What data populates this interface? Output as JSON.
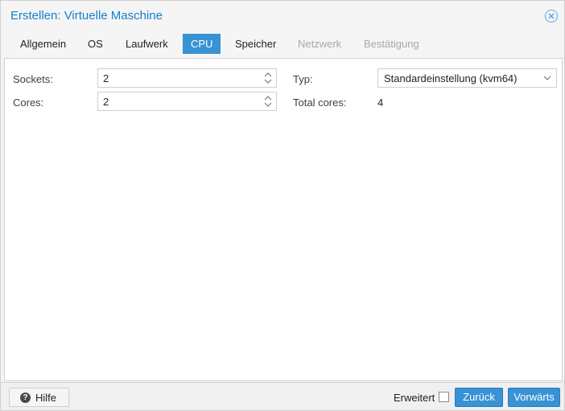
{
  "window": {
    "title": "Erstellen: Virtuelle Maschine"
  },
  "tabs": [
    {
      "label": "Allgemein",
      "state": "normal"
    },
    {
      "label": "OS",
      "state": "normal"
    },
    {
      "label": "Laufwerk",
      "state": "normal"
    },
    {
      "label": "CPU",
      "state": "active"
    },
    {
      "label": "Speicher",
      "state": "normal"
    },
    {
      "label": "Netzwerk",
      "state": "disabled"
    },
    {
      "label": "Bestätigung",
      "state": "disabled"
    }
  ],
  "form": {
    "sockets": {
      "label": "Sockets:",
      "value": "2"
    },
    "cores": {
      "label": "Cores:",
      "value": "2"
    },
    "type": {
      "label": "Typ:",
      "value": "Standardeinstellung (kvm64)"
    },
    "total_cores": {
      "label": "Total cores:",
      "value": "4"
    }
  },
  "footer": {
    "help_label": "Hilfe",
    "advanced_label": "Erweitert",
    "advanced_checked": false,
    "back_label": "Zurück",
    "next_label": "Vorwärts"
  },
  "colors": {
    "accent": "#3892d4",
    "title": "#157fcc"
  },
  "icons": {
    "close": "close-circle-icon",
    "help": "question-circle-icon"
  }
}
